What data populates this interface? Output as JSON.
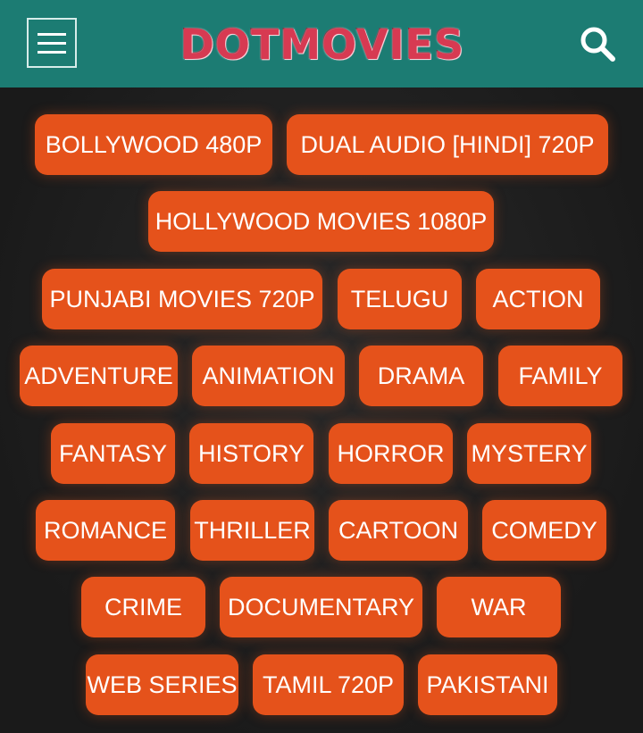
{
  "header": {
    "menu_icon": "hamburger-menu-icon",
    "logo_text": "DOTMOVIES",
    "search_icon": "search-icon",
    "accent_color": "#1c7c73"
  },
  "tags": [
    "BOLLYWOOD 480P",
    "DUAL AUDIO [HINDI] 720P",
    "HOLLYWOOD MOVIES 1080P",
    "PUNJABI MOVIES 720P",
    "TELUGU",
    "ACTION",
    "ADVENTURE",
    "ANIMATION",
    "DRAMA",
    "FAMILY",
    "FANTASY",
    "HISTORY",
    "HORROR",
    "MYSTERY",
    "ROMANCE",
    "THRILLER",
    "CARTOON",
    "COMEDY",
    "CRIME",
    "DOCUMENTARY",
    "WAR",
    "WEB SERIES",
    "TAMIL 720P",
    "PAKISTANI"
  ],
  "tag_color": "#e5521b"
}
